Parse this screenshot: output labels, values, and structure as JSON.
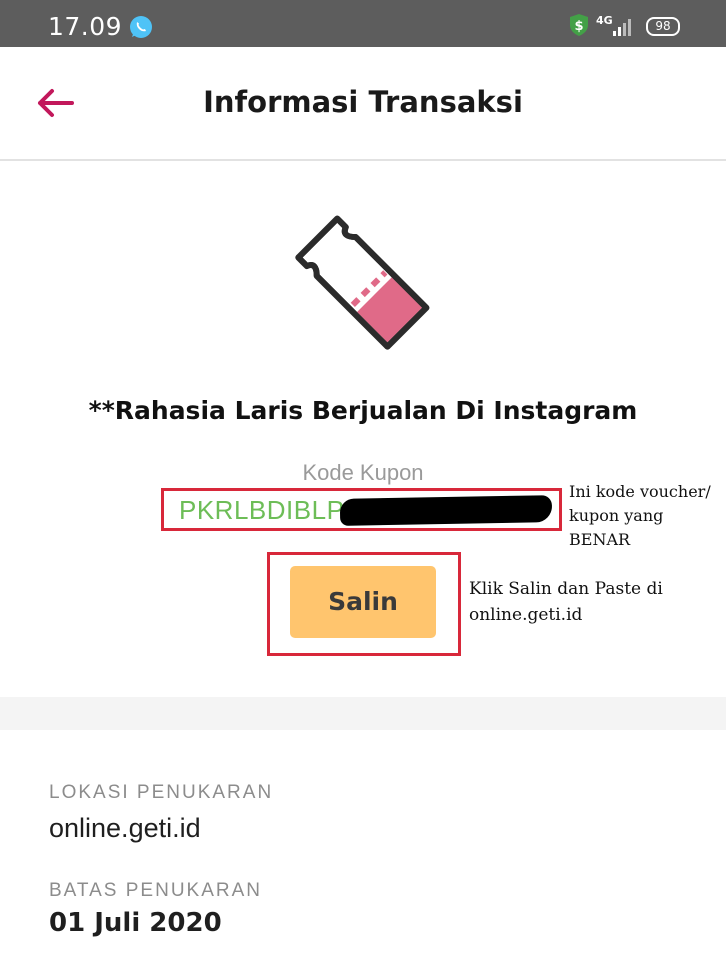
{
  "status_bar": {
    "time": "17.09",
    "network": "4G",
    "battery": "98",
    "icons": [
      "whatsapp-icon",
      "shield-dollar-icon",
      "signal-icon",
      "battery-icon"
    ]
  },
  "header": {
    "title": "Informasi Transaksi",
    "back_icon": "arrow-left-icon"
  },
  "coupon": {
    "icon": "ticket-icon",
    "product_name": "**Rahasia Laris Berjualan Di Instagram",
    "label": "Kode Kupon",
    "code_visible": "PKRLBDIBLP",
    "copy_button": "Salin"
  },
  "annotations": {
    "voucher_note": "Ini kode voucher/ kupon yang BENAR",
    "copy_note": "Klik Salin dan Paste di online.geti.id"
  },
  "details": {
    "location_label": "LOKASI PENUKARAN",
    "location_value": "online.geti.id",
    "deadline_label": "BATAS PENUKARAN",
    "deadline_value": "01 Juli 2020"
  },
  "colors": {
    "status_bar": "#5d5d5d",
    "accent": "#c2185b",
    "coupon_code": "#6dbd57",
    "copy_button": "#ffc56e",
    "annotation_frame": "#d8283a",
    "ticket_fill": "#e06a88"
  }
}
